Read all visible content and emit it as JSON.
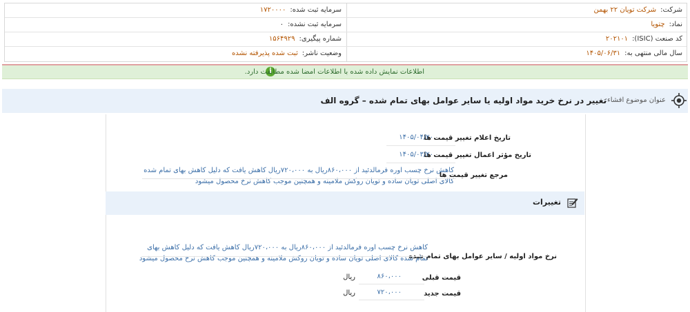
{
  "company": {
    "company_label": "شرکت:",
    "company_value": "شرکت تویان ۲۲ بهمن",
    "symbol_label": "نماد:",
    "symbol_value": "چتویا",
    "isic_label": "کد صنعت (ISIC):",
    "isic_value": "۲۰۲۱۰۱",
    "fiscal_label": "سال مالی منتهی به:",
    "fiscal_value": "۱۴۰۵/۰۶/۳۱",
    "capital_registered_label": "سرمایه ثبت شده:",
    "capital_registered_value": "۱۷۲۰۰۰۰",
    "capital_unregistered_label": "سرمایه ثبت نشده:",
    "capital_unregistered_value": "۰",
    "tracking_label": "شماره پیگیری:",
    "tracking_value": "۱۵۶۴۹۲۹",
    "publisher_label": "وضعیت ناشر:",
    "publisher_value": "ثبت شده پذیرفته نشده"
  },
  "alert": {
    "icon": "info-icon",
    "text": "اطلاعات نمایش داده شده با اطلاعات امضا شده مطابقت دارد."
  },
  "title": {
    "label": "عنوان موضوع افشاء:",
    "value": "تغییر در نرخ خرید مواد اولیه یا سایر عوامل بهای تمام شده – گروه الف"
  },
  "fields": {
    "announce_date_label": "تاریخ اعلام تغییر قیمت ها",
    "announce_date_value": "۱۴۰۵/۰۴/۲۰",
    "effective_date_label": "تاریخ مؤثر اعمال تغییر قیمت ها",
    "effective_date_value": "۱۴۰۵/۰۳/۲۰",
    "reference_label": "مرجع تغییر قیمت ها",
    "reference_value": "کاهش نرخ چسب اوره فرمالدئید از ۸۶۰،۰۰۰ریال به ۷۲۰،۰۰۰ریال کاهش یافت که دلیل کاهش بهای تمام شده کالای اصلی تویان ساده و تویان روکش ملامینه و همچنین موجب کاهش نرخ محصول میشود"
  },
  "changes": {
    "section_title": "تغییرات",
    "section_icon": "edit-icon",
    "rate_label": "نرخ مواد اولیه / سایر عوامل بهای تمام شده",
    "rate_value": "کاهش نرخ چسب اوره فرمالدئید از ۸۶۰،۰۰۰ریال به ۷۲۰،۰۰۰ریال کاهش یافت که دلیل کاهش بهای تمام شده کالای اصلی تویان ساده و تویان روکش ملامینه و همچنین موجب کاهش نرخ محصول میشود",
    "prev_price_label": "قیمت قبلی",
    "prev_price_value": "۸۶۰،۰۰۰",
    "prev_price_unit": "ریال",
    "new_price_label": "قیمت جدید",
    "new_price_value": "۷۲۰،۰۰۰",
    "new_price_unit": "ریال"
  }
}
